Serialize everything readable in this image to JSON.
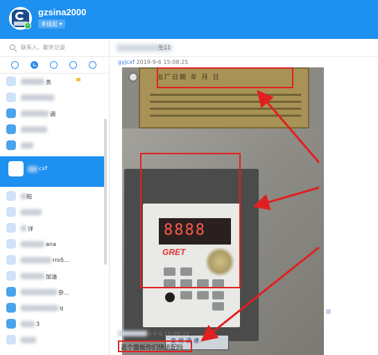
{
  "header": {
    "username": "gzsina2000",
    "status": "未挂起 ▾",
    "accent_color": "#1e90f0"
  },
  "sidebar": {
    "search_placeholder": "联系人、聊天记录",
    "tabs": [
      "chat-bubble-icon",
      "clock-icon",
      "person-icon",
      "group-icon",
      "network-icon"
    ],
    "contacts": [
      {
        "name": "务"
      },
      {
        "name": ""
      },
      {
        "name": "调"
      },
      {
        "name": ""
      },
      {
        "name": ""
      },
      {
        "name": "cxf"
      },
      {
        "name": "阳"
      },
      {
        "name": ""
      },
      {
        "name": "详"
      },
      {
        "name": "ana"
      },
      {
        "name": "rro5..."
      },
      {
        "name": "加油"
      },
      {
        "name": "杂..."
      },
      {
        "name": "q"
      },
      {
        "name": "3"
      },
      {
        "name": ""
      }
    ]
  },
  "chat": {
    "title": "生11",
    "messages": [
      {
        "sender": "gyjcxf",
        "time": "2019-9-6 15:08:25"
      },
      {
        "sender": "",
        "time": "9-9-6 15:08:33",
        "text": "这个面板你们快运配吗"
      }
    ],
    "photo": {
      "plate_text": "出厂日期 年 月 日",
      "display_digits": "8888",
      "brand": "GRET",
      "label_text": "变频调速"
    }
  }
}
